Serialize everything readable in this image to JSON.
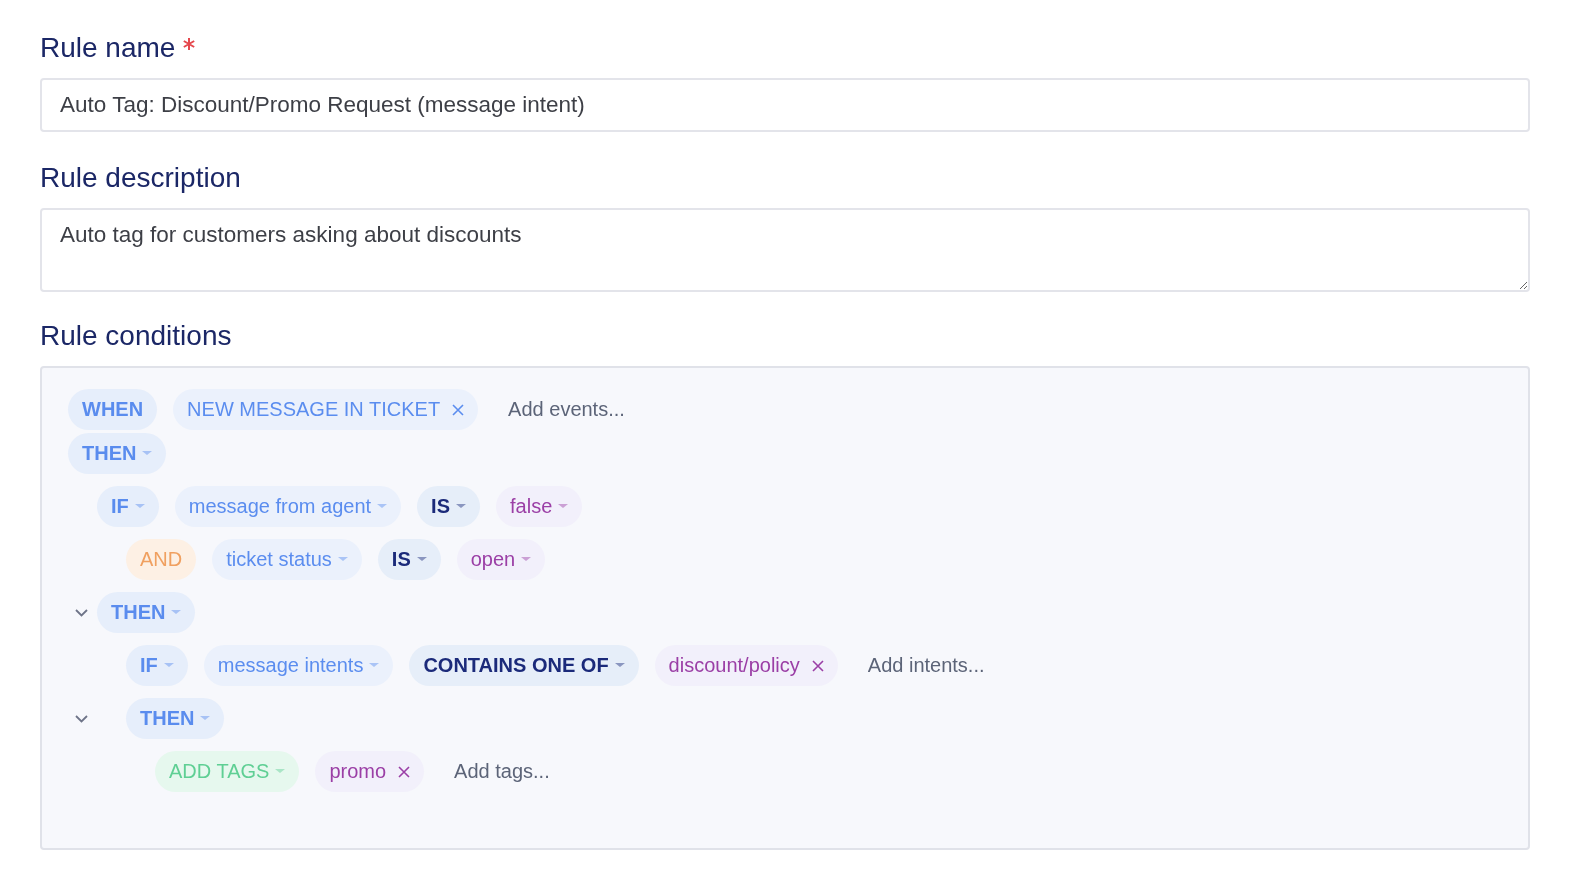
{
  "rule_name": {
    "label": "Rule name",
    "required": true,
    "value": "Auto Tag: Discount/Promo Request (message intent)"
  },
  "rule_description": {
    "label": "Rule description",
    "value": "Auto tag for customers asking about discounts"
  },
  "rule_conditions": {
    "label": "Rule conditions",
    "rows": [
      {
        "chips": [
          {
            "kind": "keyword",
            "label": "WHEN",
            "dropdown": false,
            "removable": false
          },
          {
            "kind": "field",
            "label": "NEW MESSAGE IN TICKET",
            "dropdown": false,
            "removable": true
          }
        ],
        "placeholder": "Add events..."
      },
      {
        "chips": [
          {
            "kind": "keyword",
            "label": "THEN",
            "dropdown": true,
            "removable": false
          }
        ],
        "children": [
          {
            "chips": [
              {
                "kind": "keyword",
                "label": "IF",
                "dropdown": true,
                "removable": false
              },
              {
                "kind": "field",
                "label": "message from agent",
                "dropdown": true,
                "removable": false
              },
              {
                "kind": "operator",
                "label": "IS",
                "dropdown": true,
                "removable": false
              },
              {
                "kind": "value",
                "label": "false",
                "dropdown": true,
                "removable": false
              }
            ],
            "children": [
              {
                "chips": [
                  {
                    "kind": "logic",
                    "label": "AND",
                    "dropdown": false,
                    "removable": false
                  },
                  {
                    "kind": "field",
                    "label": "ticket status",
                    "dropdown": true,
                    "removable": false
                  },
                  {
                    "kind": "operator",
                    "label": "IS",
                    "dropdown": true,
                    "removable": false
                  },
                  {
                    "kind": "value",
                    "label": "open",
                    "dropdown": true,
                    "removable": false
                  }
                ]
              }
            ]
          },
          {
            "expanded": true,
            "chips": [
              {
                "kind": "keyword",
                "label": "THEN",
                "dropdown": true,
                "removable": false
              }
            ],
            "children": [
              {
                "chips": [
                  {
                    "kind": "keyword",
                    "label": "IF",
                    "dropdown": true,
                    "removable": false
                  },
                  {
                    "kind": "field",
                    "label": "message intents",
                    "dropdown": true,
                    "removable": false
                  },
                  {
                    "kind": "operator",
                    "label": "CONTAINS ONE OF",
                    "dropdown": true,
                    "removable": false
                  },
                  {
                    "kind": "value",
                    "label": "discount/policy",
                    "dropdown": false,
                    "removable": true
                  }
                ],
                "placeholder": "Add intents..."
              },
              {
                "expanded": true,
                "chips": [
                  {
                    "kind": "keyword",
                    "label": "THEN",
                    "dropdown": true,
                    "removable": false
                  }
                ],
                "children": [
                  {
                    "chips": [
                      {
                        "kind": "action",
                        "label": "ADD TAGS",
                        "dropdown": true,
                        "removable": false
                      },
                      {
                        "kind": "value",
                        "label": "promo",
                        "dropdown": false,
                        "removable": true
                      }
                    ],
                    "placeholder": "Add tags..."
                  }
                ]
              }
            ]
          }
        ]
      }
    ]
  }
}
